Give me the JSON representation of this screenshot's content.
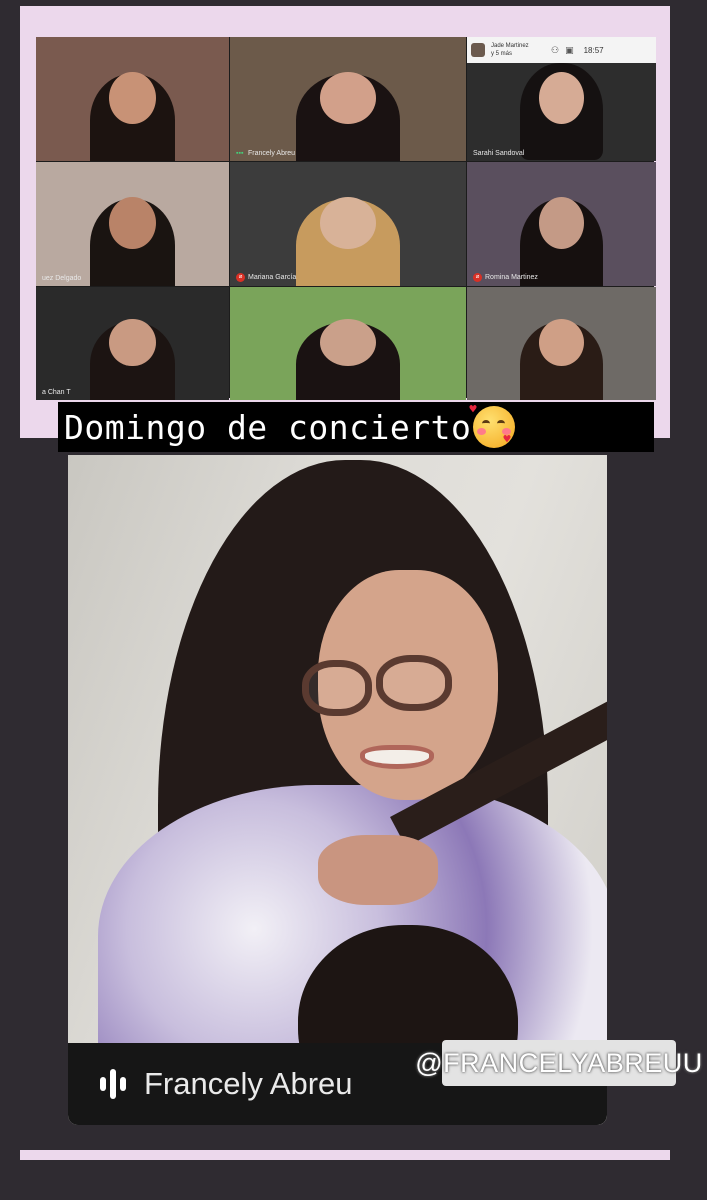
{
  "meeting_grid": {
    "top_overlay": {
      "participants_text_line1": "Jade Martinez",
      "participants_text_line2": "y 5 más",
      "time": "18:57"
    },
    "tiles": [
      {
        "name": "",
        "bg": "#7a5a4f",
        "skin": "#c89276",
        "hair": "#1c1310",
        "name_visible": false
      },
      {
        "name": "Francely Abreu",
        "bg": "#6c5a4a",
        "skin": "#d2a08a",
        "hair": "#1a1212",
        "name_visible": true,
        "mic": "green"
      },
      {
        "name": "Sarahi Sandoval",
        "bg": "#2d2d2d",
        "skin": "#d6ab95",
        "hair": "#151111",
        "name_visible": true,
        "mic": "none"
      },
      {
        "name": "uez Delgado",
        "bg": "#b9a9a0",
        "skin": "#b98368",
        "hair": "#1a1411",
        "name_visible": true,
        "mic": "none"
      },
      {
        "name": "Mariana García",
        "bg": "#3c3c3c",
        "skin": "#d8b298",
        "hair": "#c79b5e",
        "name_visible": true,
        "mic": "red"
      },
      {
        "name": "Romina Martinez",
        "bg": "#5a4f5e",
        "skin": "#c49a86",
        "hair": "#16100f",
        "name_visible": true,
        "mic": "red"
      },
      {
        "name": "a Chan T",
        "bg": "#2a2a2a",
        "skin": "#c99a82",
        "hair": "#1c1412",
        "name_visible": true,
        "mic": "none"
      },
      {
        "name": "",
        "bg": "#7aa45a",
        "skin": "#caa08a",
        "hair": "#1a1212",
        "name_visible": false
      },
      {
        "name": "",
        "bg": "#6e6a66",
        "skin": "#cf9f86",
        "hair": "#2a1c16",
        "name_visible": false
      }
    ]
  },
  "caption": {
    "text": "Domingo de concierto",
    "emoji": "smiling-face-with-hearts"
  },
  "presenter": {
    "name": "Francely Abreu"
  },
  "handle_sticker": {
    "text": "@FRANCELYABREUU"
  },
  "colors": {
    "frame": "#ecd8ec",
    "background": "#2f2b31",
    "hoodie_accent": "#8c78b7",
    "mic_off": "#d93025"
  }
}
